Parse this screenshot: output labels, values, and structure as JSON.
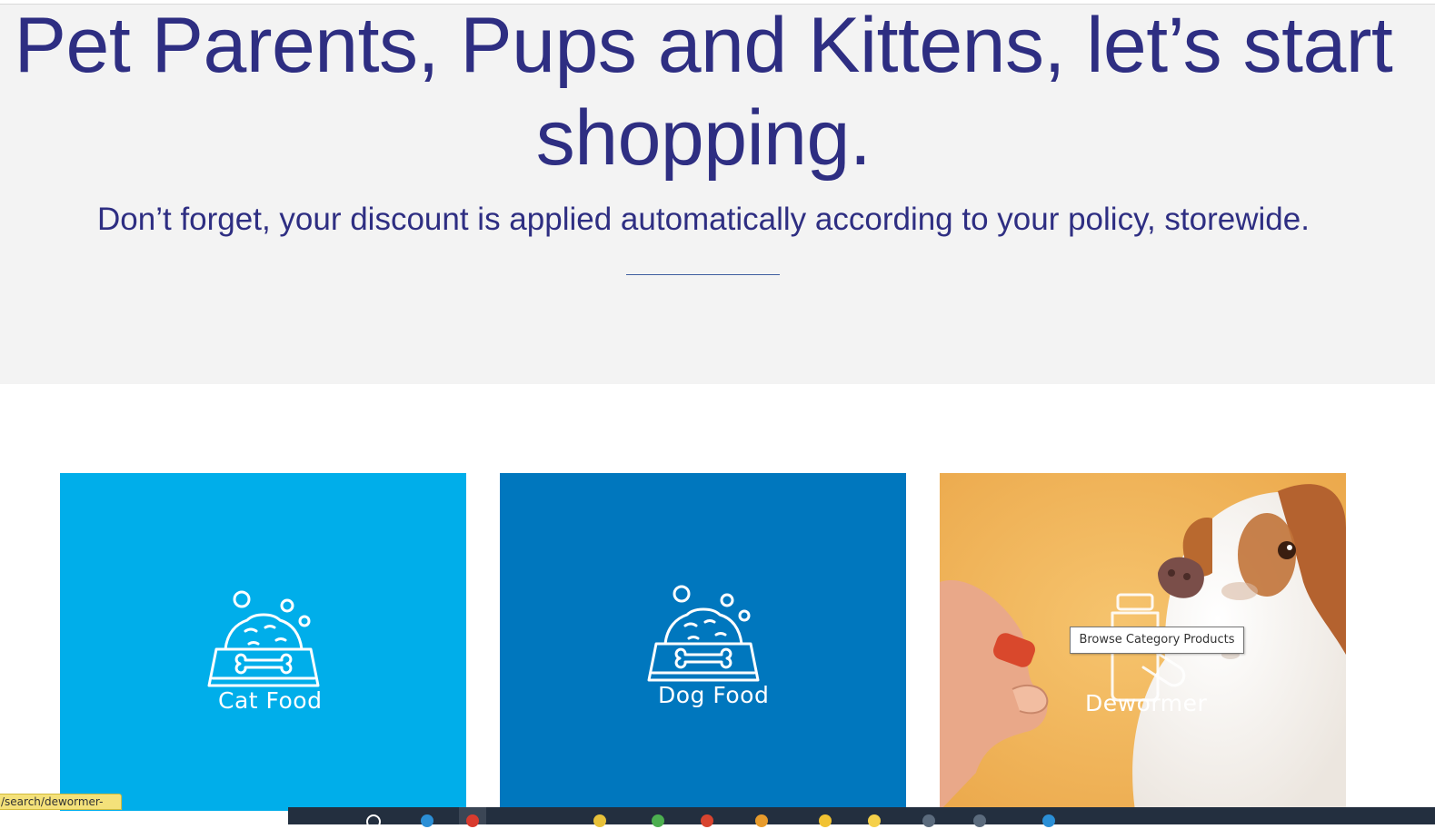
{
  "hero": {
    "title": "Pet Parents, Pups and Kittens, let’s start shopping.",
    "subtitle": "Don’t forget, your discount is applied automatically according to your policy, storewide."
  },
  "categories": [
    {
      "label": "Cat Food",
      "icon": "pet-food-bowl-icon",
      "background": "#00aeea"
    },
    {
      "label": "Dog Food",
      "icon": "pet-food-bowl-icon",
      "background": "#0077be"
    },
    {
      "label": "Dewormer",
      "icon": "medicine-bottle-icon",
      "background": "#f2b65a"
    }
  ],
  "tooltip": {
    "text": "Browse Category Products"
  },
  "status_bar": {
    "url": "/search/dewormer-"
  },
  "colors": {
    "heading": "#2e2e82",
    "hero_background": "#f3f3f3",
    "cat_tile": "#00aeea",
    "dog_tile": "#0077be",
    "taskbar": "#232f3f"
  },
  "taskbar": {
    "icons": [
      "search-icon",
      "edge-icon",
      "chrome-icon",
      "app-icon",
      "app-icon",
      "app-icon",
      "app-icon",
      "app-icon",
      "app-icon",
      "app-icon",
      "app-icon",
      "app-icon",
      "app-icon"
    ]
  }
}
